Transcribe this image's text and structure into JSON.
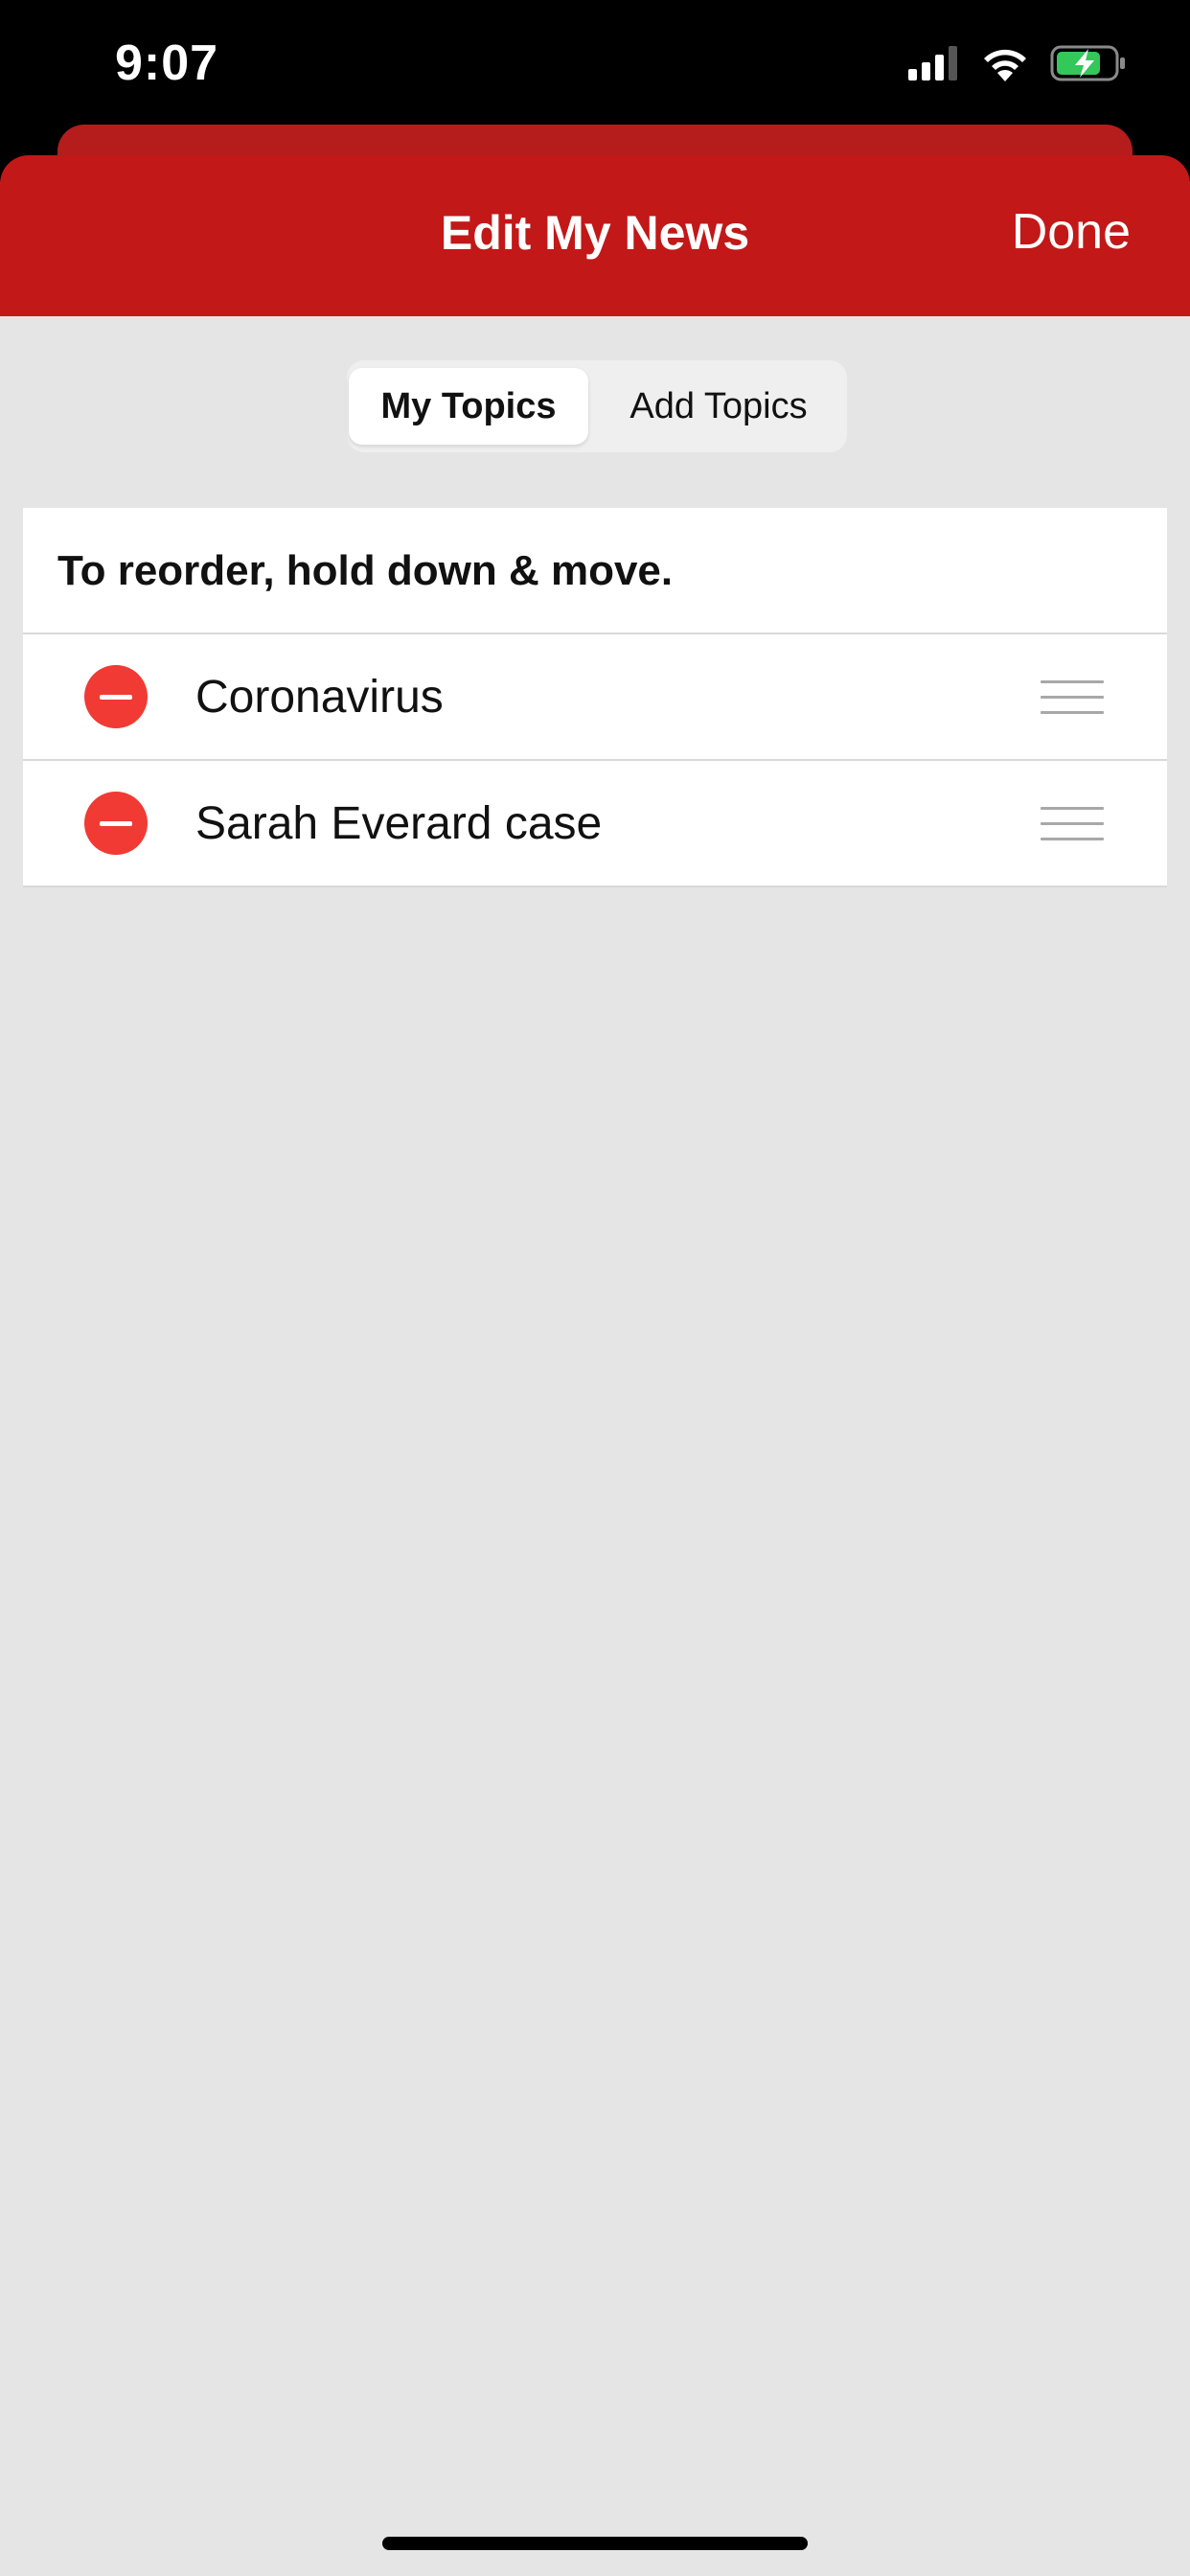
{
  "status_bar": {
    "time": "9:07",
    "icons": [
      "cellular-signal-icon",
      "wifi-icon",
      "battery-charging-icon"
    ]
  },
  "header": {
    "title": "Edit My News",
    "done_label": "Done",
    "background_color": "#c21818"
  },
  "segmented_control": {
    "tabs": [
      {
        "label": "My Topics",
        "selected": true
      },
      {
        "label": "Add Topics",
        "selected": false
      }
    ]
  },
  "list": {
    "instruction": "To reorder, hold down & move.",
    "topics": [
      {
        "label": "Coronavirus"
      },
      {
        "label": "Sarah Everard case"
      }
    ]
  },
  "colors": {
    "accent_red": "#c21818",
    "remove_red": "#f03a33",
    "background": "#e5e5e5"
  }
}
